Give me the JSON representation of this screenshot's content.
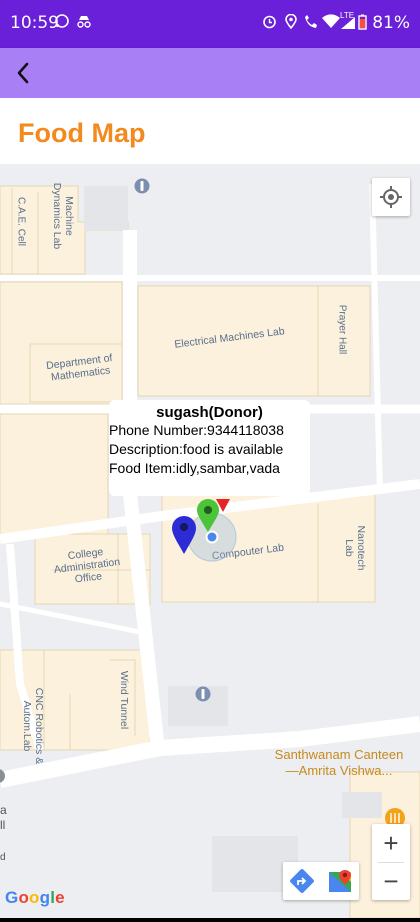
{
  "status_bar": {
    "time": "10:59",
    "network": "LTE",
    "battery": "81%"
  },
  "page": {
    "title": "Food Map"
  },
  "map": {
    "labels": {
      "cae_cell": "C.A.E. Cell",
      "machine_dynamics": "Machine Dynamics Lab",
      "electrical_machines": "Electrical Machines Lab",
      "prayer_hall": "Prayer Hall",
      "dept_math": "Department of Mathematics",
      "college_admin": "College Administration Office",
      "computer_lab": "Compouter Lab",
      "nanotech": "Nanotech Lab",
      "cnc": "CNC Robotics & Autom.Lab",
      "wind_tunnel": "Wind Tunnel",
      "canteen_line1": "Santhwanam Canteen",
      "canteen_line2": "—Amrita Vishwa...",
      "edge_a": "a",
      "edge_ll": "ll",
      "edge_d": "d"
    },
    "info_window": {
      "title": "sugash(Donor)",
      "phone": "Phone Number:9344118038",
      "description": "Description:food is available",
      "food_item": "Food Item:idly,sambar,vada"
    },
    "zoom_in": "+",
    "zoom_out": "−",
    "attribution": {
      "g1": "G",
      "g2": "o",
      "g3": "o",
      "g4": "g",
      "g5": "l",
      "g6": "e"
    },
    "colors": {
      "marker_blue": "#2d2bd6",
      "marker_green": "#4cc43a",
      "marker_red": "#e5232b",
      "poi": "#f3a21a"
    }
  }
}
